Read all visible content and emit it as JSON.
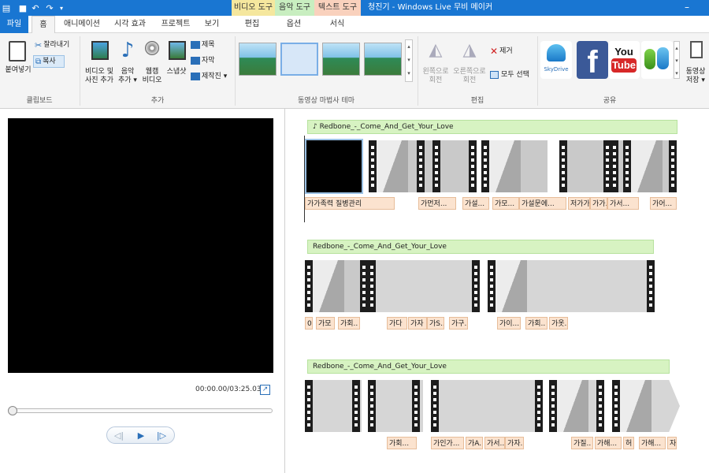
{
  "title_bar": {
    "title": "청진기 - Windows Live 무비 메이커",
    "minimize": "–",
    "contextual_tabs": {
      "video": "비디오 도구",
      "music": "음악 도구",
      "text": "텍스트 도구"
    }
  },
  "tabs": [
    "파일",
    "홈",
    "애니메이션",
    "시각 효과",
    "프로젝트",
    "보기",
    "편집",
    "옵션",
    "서식"
  ],
  "ribbon": {
    "clipboard": {
      "paste": "붙여넣기",
      "cut": "잘라내기",
      "copy": "복사",
      "group": "클립보드"
    },
    "add": {
      "add_video_photo": [
        "비디오 및",
        "사진 추가"
      ],
      "add_music": [
        "음악",
        "추가 ▾"
      ],
      "webcam": [
        "웹캠",
        "비디오"
      ],
      "snapshot": "스냅샷",
      "title": "제목",
      "caption": "자막",
      "credits": "제작진 ▾",
      "group": "추가"
    },
    "themes": {
      "group": "동영상 마법사 테마"
    },
    "edit": {
      "rotate_left": [
        "왼쪽으로",
        "회전"
      ],
      "rotate_right": [
        "오른쪽으로",
        "회전"
      ],
      "remove": "제거",
      "select_all": "모두 선택",
      "group": "편집"
    },
    "share": {
      "skydrive": "SkyDrive",
      "facebook": "f",
      "youtube_top": "You",
      "youtube_bottom": "Tube",
      "save_movie": [
        "동영상",
        "저장 ▾"
      ],
      "group": "공유"
    }
  },
  "player": {
    "timecode": "00:00.00/03:25.03"
  },
  "storyboard": {
    "tracks": [
      {
        "music": "Redbone_-_Come_And_Get_Your_Love",
        "captions": [
          "가가족력 질병관리",
          "가먼저...",
          "가설...",
          "가모...",
          "가설문에...",
          "저가가...",
          "가가...",
          "가서...",
          "가어..."
        ]
      },
      {
        "music": "Redbone_-_Come_And_Get_Your_Love",
        "captions": [
          "0",
          "가모",
          "가회..",
          "가다",
          "가자",
          "가S..",
          "가구.",
          "가이...",
          "가회..",
          "가옷."
        ]
      },
      {
        "music": "Redbone_-_Come_And_Get_Your_Love",
        "captions": [
          "가회...",
          "가인가...",
          "가A..",
          "가서..",
          "가자.",
          "가질..",
          "가해...",
          "허",
          "가해...",
          "자"
        ]
      }
    ]
  },
  "colors": {
    "accent": "#1976d2",
    "video_tools": "#f5e79e",
    "music_tools": "#c8eec0",
    "text_tools": "#f9d1bd",
    "music_bar": "#d7f3c2",
    "caption": "#fbe3cf"
  }
}
